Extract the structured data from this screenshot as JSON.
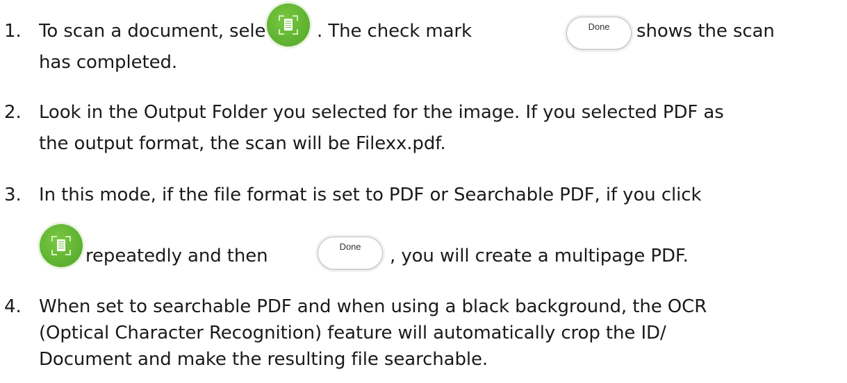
{
  "items": [
    {
      "number": "1.",
      "line1_a": "To scan a document, select",
      "line1_b": ". The check mark",
      "line1_c": "shows the scan",
      "line2": "has completed."
    },
    {
      "number": "2.",
      "line1": "Look in the Output Folder you selected for the image. If you selected PDF as",
      "line2": "the output format, the scan will be Filexx.pdf."
    },
    {
      "number": "3.",
      "line1": "In this mode, if the file format is set to PDF or Searchable PDF, if you click",
      "line2_a": "repeatedly and then",
      "line2_b": ", you will create a multipage PDF."
    },
    {
      "number": "4.",
      "line1": "When set to searchable PDF and when using a black background, the OCR",
      "line2": "(Optical Character Recognition) feature will automatically crop the ID/",
      "line3": "Document and make the resulting file searchable."
    }
  ],
  "buttons": {
    "done_label": "Done",
    "scan_icon": "scan-document-icon",
    "scan_color": "#62b533"
  }
}
